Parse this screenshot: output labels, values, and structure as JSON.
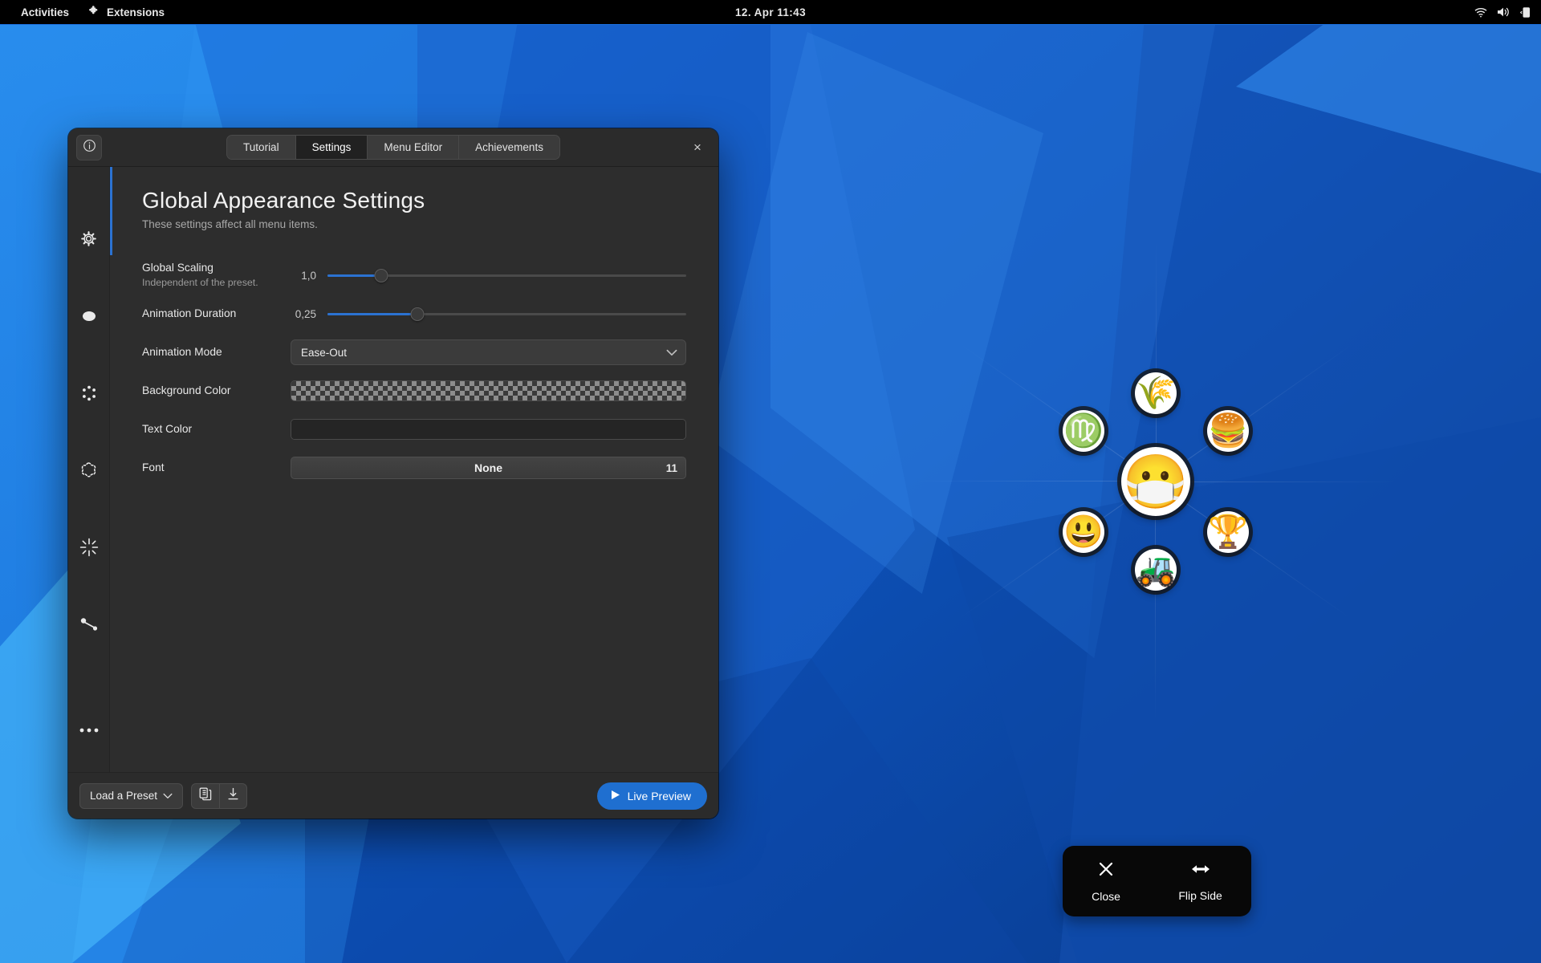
{
  "topbar": {
    "activities": "Activities",
    "extensions": "Extensions",
    "extensions_icon": "puzzle-piece-icon",
    "clock": "12. Apr  11:43",
    "indicators": [
      "wifi-icon",
      "volume-icon",
      "battery-icon"
    ]
  },
  "window": {
    "info_button_icon": "info-circle-icon",
    "close_label": "×",
    "tabs": [
      {
        "label": "Tutorial",
        "active": false
      },
      {
        "label": "Settings",
        "active": true
      },
      {
        "label": "Menu Editor",
        "active": false
      },
      {
        "label": "Achievements",
        "active": false
      }
    ],
    "sidebar": [
      {
        "name": "sidebar-item-general",
        "icon": "gear-circle-icon"
      },
      {
        "name": "sidebar-item-center",
        "icon": "filled-circle-icon"
      },
      {
        "name": "sidebar-item-children",
        "icon": "dots-ring-icon"
      },
      {
        "name": "sidebar-item-grandchildren",
        "icon": "dotted-gear-icon"
      },
      {
        "name": "sidebar-item-trace",
        "icon": "burst-icon"
      },
      {
        "name": "sidebar-item-connectors",
        "icon": "connector-icon"
      },
      {
        "name": "sidebar-item-advanced",
        "icon": "three-dots-icon"
      }
    ],
    "page": {
      "title": "Global Appearance Settings",
      "subtitle": "These settings affect all menu items.",
      "accent_color": "#2b72d1"
    },
    "settings": {
      "global_scaling": {
        "label": "Global Scaling",
        "sublabel": "Independent of the preset.",
        "value": "1,0",
        "percent": 15
      },
      "animation_duration": {
        "label": "Animation Duration",
        "value": "0,25",
        "percent": 25
      },
      "animation_mode": {
        "label": "Animation Mode",
        "value": "Ease-Out",
        "chevron_icon": "chevron-down-icon"
      },
      "background_color": {
        "label": "Background Color",
        "swatch": "transparent-checkerboard"
      },
      "text_color": {
        "label": "Text Color",
        "swatch": "#252525"
      },
      "font": {
        "label": "Font",
        "family": "None",
        "size": "11"
      }
    },
    "footer": {
      "load_preset": "Load a Preset",
      "load_preset_chevron": "chevron-down-icon",
      "copy_icon": "copy-preset-icon",
      "import_icon": "download-preset-icon",
      "live_preview": "Live Preview",
      "live_preview_icon": "play-icon",
      "live_preview_color": "#1f6fd0"
    }
  },
  "pie_menu": {
    "center": {
      "name": "pie-center-item",
      "emoji": "😷",
      "icon": "face-with-medical-mask"
    },
    "items": [
      {
        "name": "pie-item-top",
        "emoji": "🌾",
        "icon": "sheaf-of-rice",
        "angle": -90,
        "radius": 110
      },
      {
        "name": "pie-item-top-right",
        "emoji": "🍔",
        "icon": "hamburger",
        "angle": -35,
        "radius": 110
      },
      {
        "name": "pie-item-bottom-right",
        "emoji": "🏆",
        "icon": "trophy",
        "angle": 35,
        "radius": 110
      },
      {
        "name": "pie-item-bottom",
        "emoji": "🚜",
        "icon": "tractor",
        "angle": 90,
        "radius": 110
      },
      {
        "name": "pie-item-bottom-left",
        "emoji": "😃",
        "icon": "grinning-face",
        "angle": 145,
        "radius": 110
      },
      {
        "name": "pie-item-top-left",
        "emoji": "♍",
        "icon": "virgo-sign",
        "angle": -145,
        "radius": 110
      }
    ]
  },
  "pie_actions": [
    {
      "name": "pie-action-close",
      "label": "Close",
      "icon": "close-x-icon"
    },
    {
      "name": "pie-action-flip",
      "label": "Flip Side",
      "icon": "left-right-arrow-icon"
    }
  ]
}
